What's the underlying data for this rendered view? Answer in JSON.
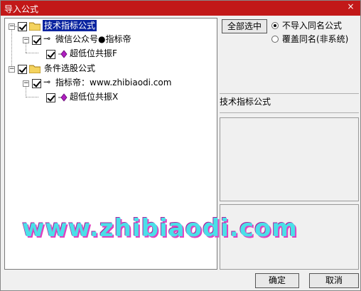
{
  "window": {
    "title": "导入公式",
    "close_label": "×"
  },
  "tree": {
    "root1": {
      "label": "技术指标公式"
    },
    "child1": {
      "label": "微信公众号●指标帝"
    },
    "leaf1": {
      "label": "超低位共振F"
    },
    "root2": {
      "label": "条件选股公式"
    },
    "child2": {
      "label": "指标帝：www.zhibiaodi.com"
    },
    "leaf2": {
      "label": "超低位共振X"
    }
  },
  "options": {
    "select_all_label": "全部选中",
    "radio1_label": "不导入同名公式",
    "radio2_label": "覆盖同名(非系统)",
    "selected_radio": "radio1"
  },
  "detail": {
    "category_label": "技术指标公式"
  },
  "footer": {
    "ok_label": "确定",
    "cancel_label": "取消"
  },
  "watermark": {
    "text": "www.zhibiaodi.com"
  }
}
